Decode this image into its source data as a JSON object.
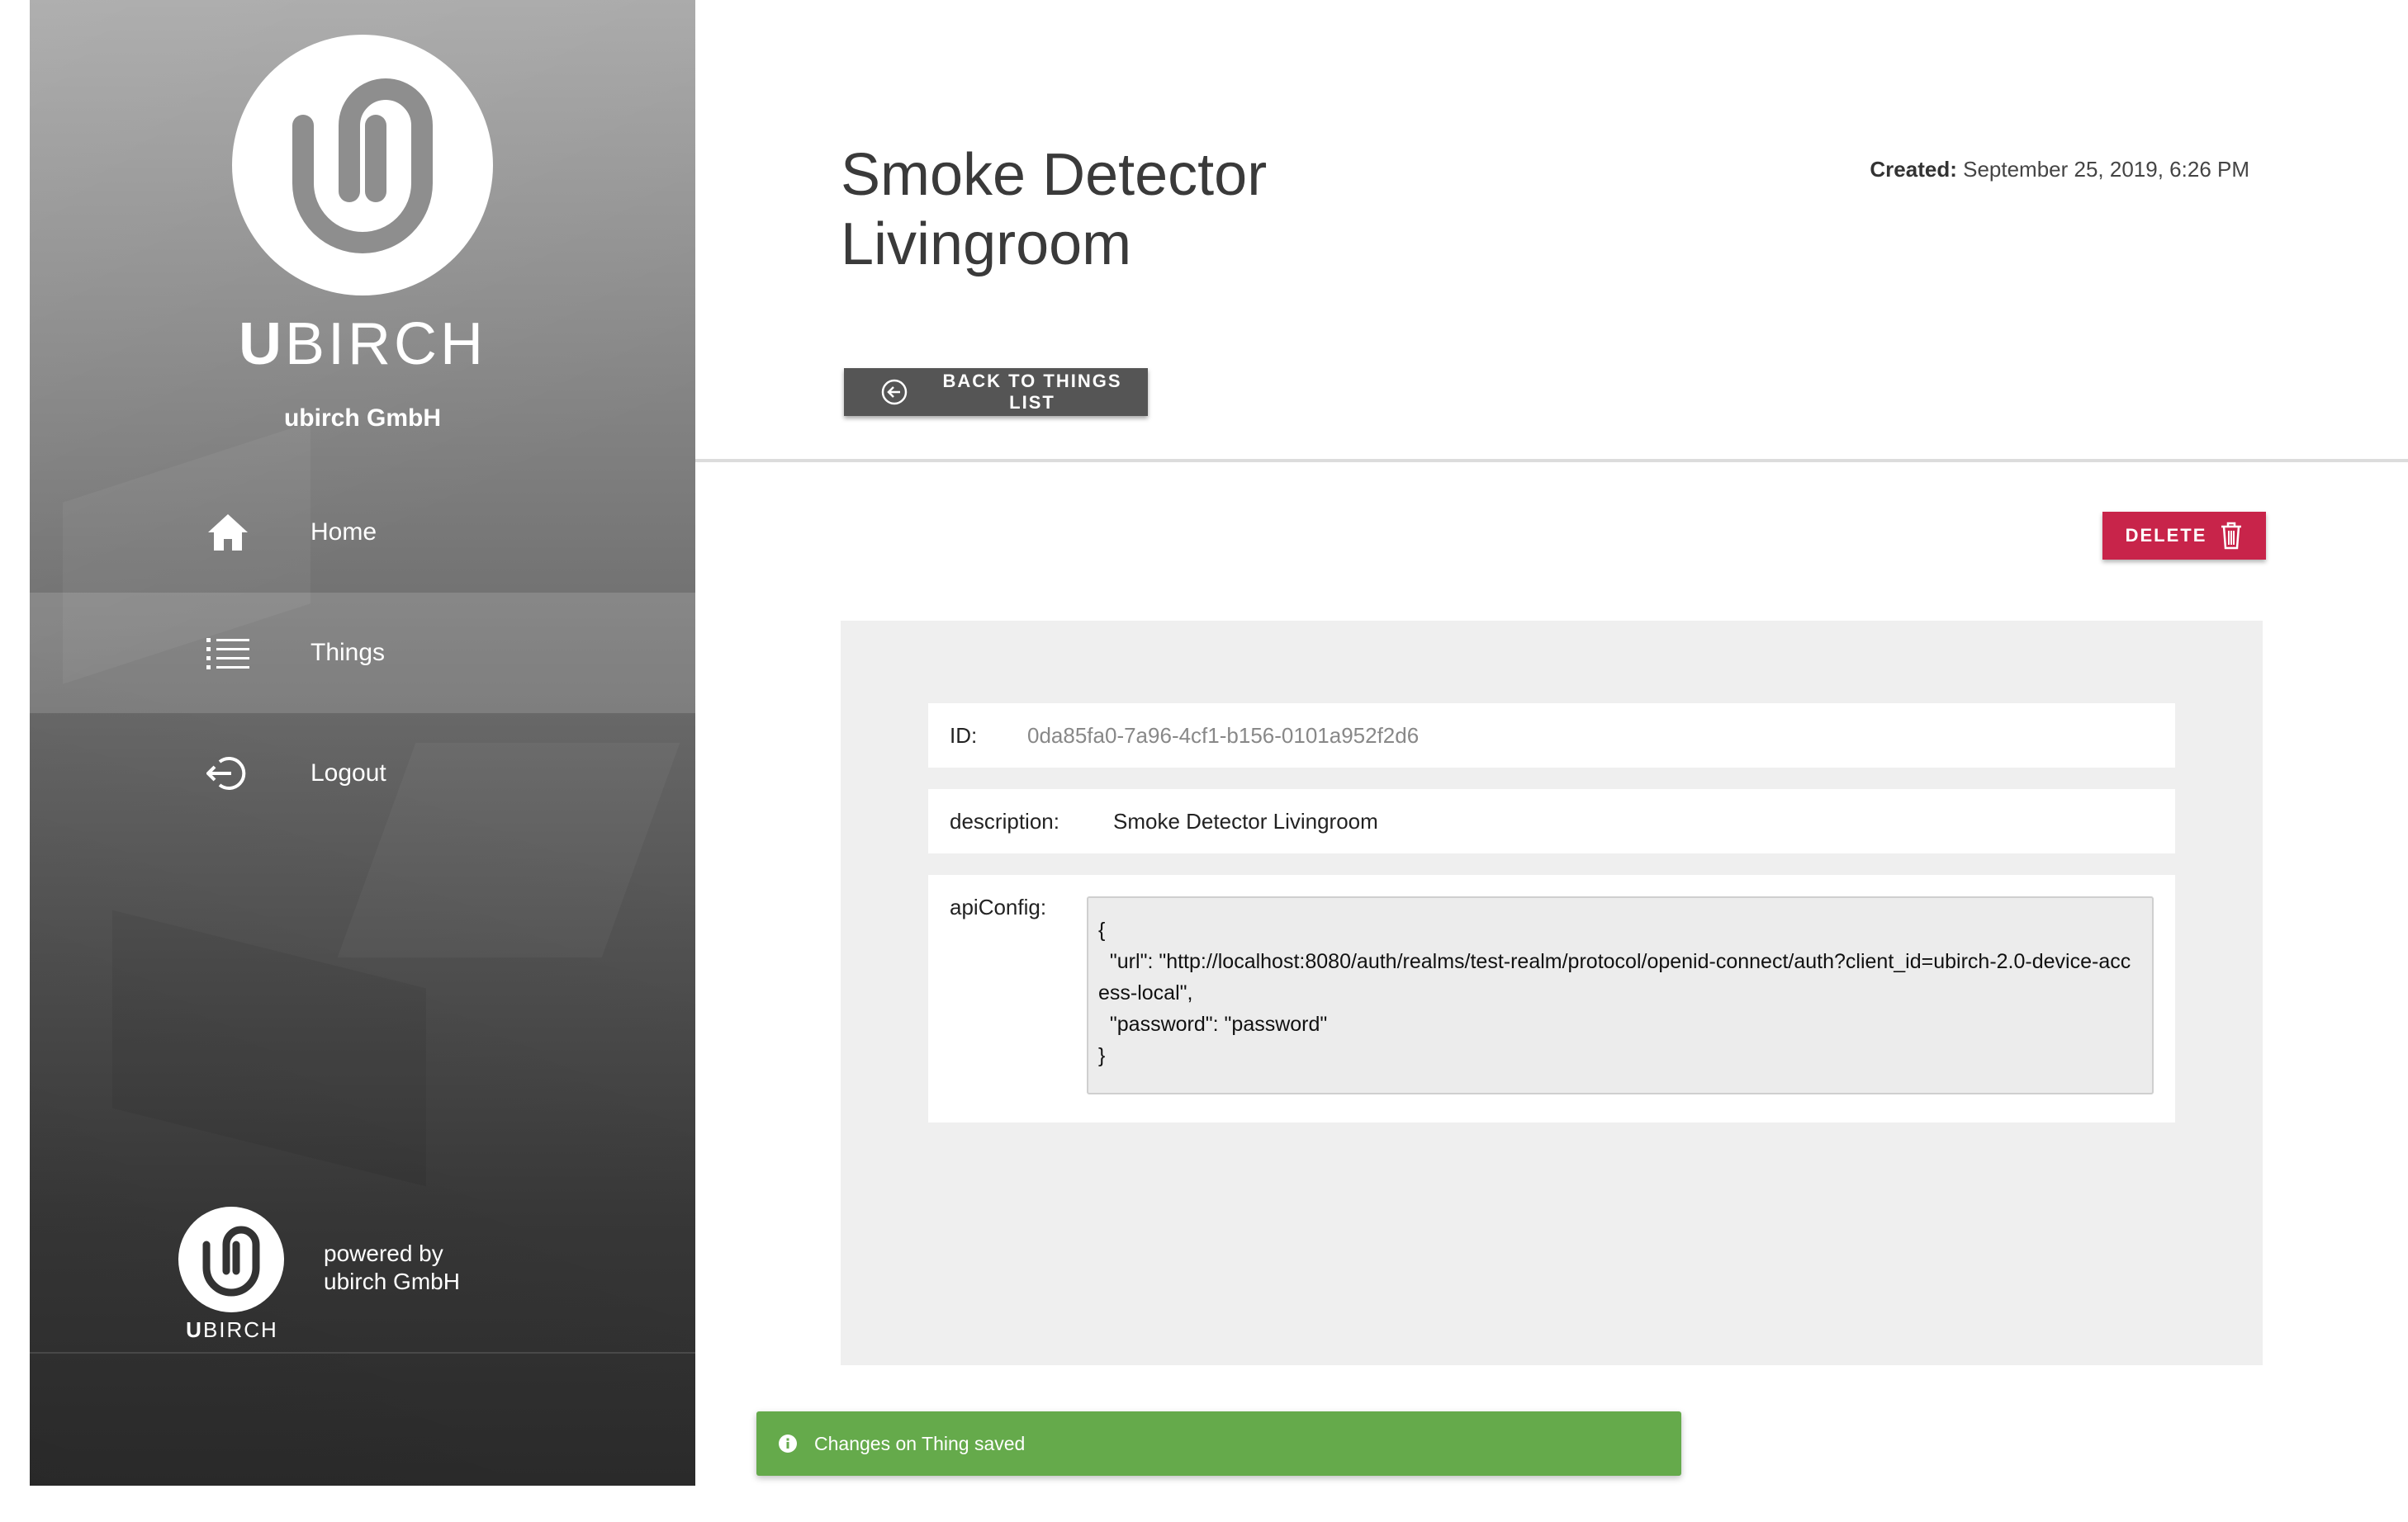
{
  "sidebar": {
    "logo_icon": "ubirch-logo",
    "brand_text_bold": "U",
    "brand_text_rest": "BIRCH",
    "org_name": "ubirch GmbH",
    "items": [
      {
        "label": "Home",
        "icon": "home-icon",
        "active": false
      },
      {
        "label": "Things",
        "icon": "list-icon",
        "active": true
      },
      {
        "label": "Logout",
        "icon": "logout-icon",
        "active": false
      }
    ],
    "footer": {
      "brand_bold": "U",
      "brand_rest": "BIRCH",
      "powered_line1": "powered by",
      "powered_line2": "ubirch GmbH"
    }
  },
  "header": {
    "title": "Smoke Detector Livingroom",
    "created_label": "Created:",
    "created_value": "September 25, 2019, 6:26 PM",
    "back_button_label": "BACK TO THINGS LIST"
  },
  "actions": {
    "delete_label": "DELETE"
  },
  "thing": {
    "id_label": "ID:",
    "id_value": "0da85fa0-7a96-4cf1-b156-0101a952f2d6",
    "description_label": "description:",
    "description_value": "Smoke Detector Livingroom",
    "apiconfig_label": "apiConfig:",
    "apiconfig_value": "{\n  \"url\": \"http://localhost:8080/auth/realms/test-realm/protocol/openid-connect/auth?client_id=ubirch-2.0-device-access-local\",\n  \"password\": \"password\"\n}"
  },
  "toast": {
    "message": "Changes on Thing saved"
  },
  "colors": {
    "delete": "#c8244a",
    "toast": "#65aa4b",
    "back_button": "#555555"
  }
}
